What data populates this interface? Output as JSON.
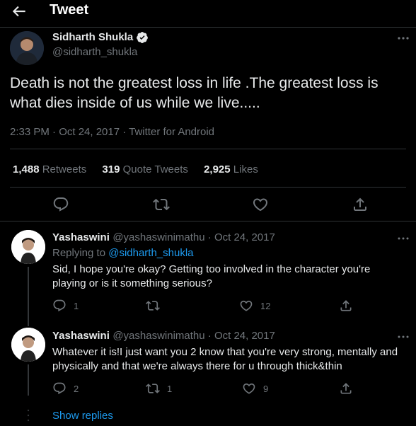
{
  "header": {
    "title": "Tweet"
  },
  "main_tweet": {
    "author_name": "Sidharth Shukla",
    "author_handle": "@sidharth_shukla",
    "text": "Death is not the greatest loss in life .The greatest loss is what dies inside of us while we live.....",
    "meta": "2:33 PM · Oct 24, 2017 · Twitter for Android",
    "stats": {
      "retweets_count": "1,488",
      "retweets_label": "Retweets",
      "quotes_count": "319",
      "quotes_label": "Quote Tweets",
      "likes_count": "2,925",
      "likes_label": "Likes"
    }
  },
  "replies": [
    {
      "author_name": "Yashaswini",
      "author_meta": "@yashaswinimathu · Oct 24, 2017",
      "replying_prefix": "Replying to",
      "replying_handle": "@sidharth_shukla",
      "text": "Sid, I hope you're okay? Getting too involved in the character you're playing or is it something serious?",
      "reply_count": "1",
      "retweet_count": "",
      "like_count": "12"
    },
    {
      "author_name": "Yashaswini",
      "author_meta": "@yashaswinimathu · Oct 24, 2017",
      "text": "Whatever it is!I just want you 2 know that you're very strong, mentally and physically and that we're always there for u through thick&thin",
      "reply_count": "2",
      "retweet_count": "1",
      "like_count": "9"
    }
  ],
  "show_replies": "Show replies",
  "icons": [
    "back-arrow-icon",
    "verified-badge-icon",
    "more-icon",
    "reply-icon",
    "retweet-icon",
    "like-icon",
    "share-icon"
  ],
  "colors": {
    "background": "#000000",
    "text": "#e7e9ea",
    "muted": "#71767b",
    "accent": "#1d9bf0",
    "divider": "#2f3336"
  }
}
